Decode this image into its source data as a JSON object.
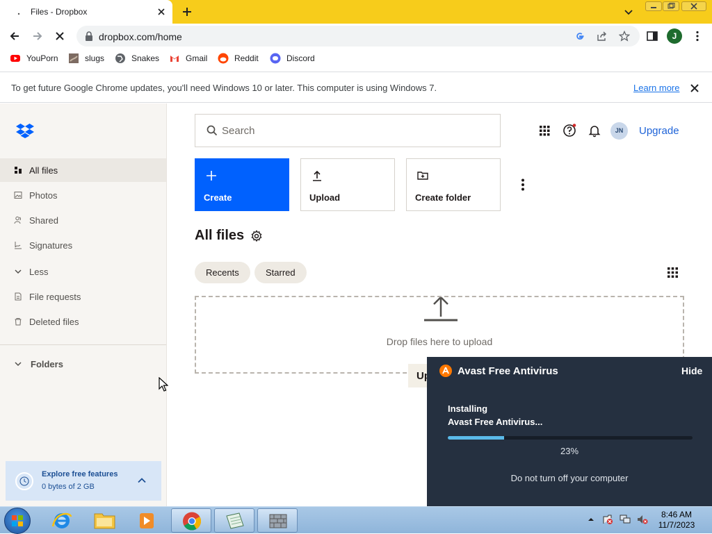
{
  "browser": {
    "tab_title": "Files - Dropbox",
    "url": "dropbox.com/home",
    "profile_initial": "J",
    "bookmarks": [
      "YouPorn",
      "slugs",
      "Snakes",
      "Gmail",
      "Reddit",
      "Discord"
    ],
    "infobar": {
      "message": "To get future Google Chrome updates, you'll need Windows 10 or later. This computer is using Windows 7.",
      "link": "Learn more"
    }
  },
  "sidebar": {
    "items": [
      {
        "label": "All files",
        "icon": "files-icon",
        "active": true
      },
      {
        "label": "Photos",
        "icon": "photo-icon"
      },
      {
        "label": "Shared",
        "icon": "shared-icon"
      },
      {
        "label": "Signatures",
        "icon": "signature-icon"
      },
      {
        "label": "Less",
        "icon": "chevron-down-icon"
      },
      {
        "label": "File requests",
        "icon": "file-request-icon"
      },
      {
        "label": "Deleted files",
        "icon": "trash-icon"
      }
    ],
    "folders_label": "Folders",
    "explore": {
      "title": "Explore free features",
      "subtitle": "0 bytes of 2 GB"
    }
  },
  "header": {
    "search_placeholder": "Search",
    "avatar_initials": "JN",
    "upgrade_label": "Upgrade"
  },
  "actions": {
    "create": "Create",
    "upload": "Upload",
    "create_folder": "Create folder"
  },
  "main": {
    "title": "All files",
    "chips": [
      "Recents",
      "Starred"
    ],
    "drop_text": "Drop files here to upload",
    "upload_fragment": "Up"
  },
  "avast": {
    "title": "Avast Free Antivirus",
    "hide": "Hide",
    "line1": "Installing",
    "line2": "Avast Free Antivirus...",
    "progress_percent": 23,
    "percent_text": "23%",
    "note": "Do not turn off your computer"
  },
  "taskbar": {
    "time": "8:46 AM",
    "date": "11/7/2023"
  },
  "colors": {
    "chrome_frame": "#f7cc1b",
    "dropbox_blue": "#0061fe",
    "avast_bg": "#253040",
    "avast_progress": "#5ab9e8"
  }
}
